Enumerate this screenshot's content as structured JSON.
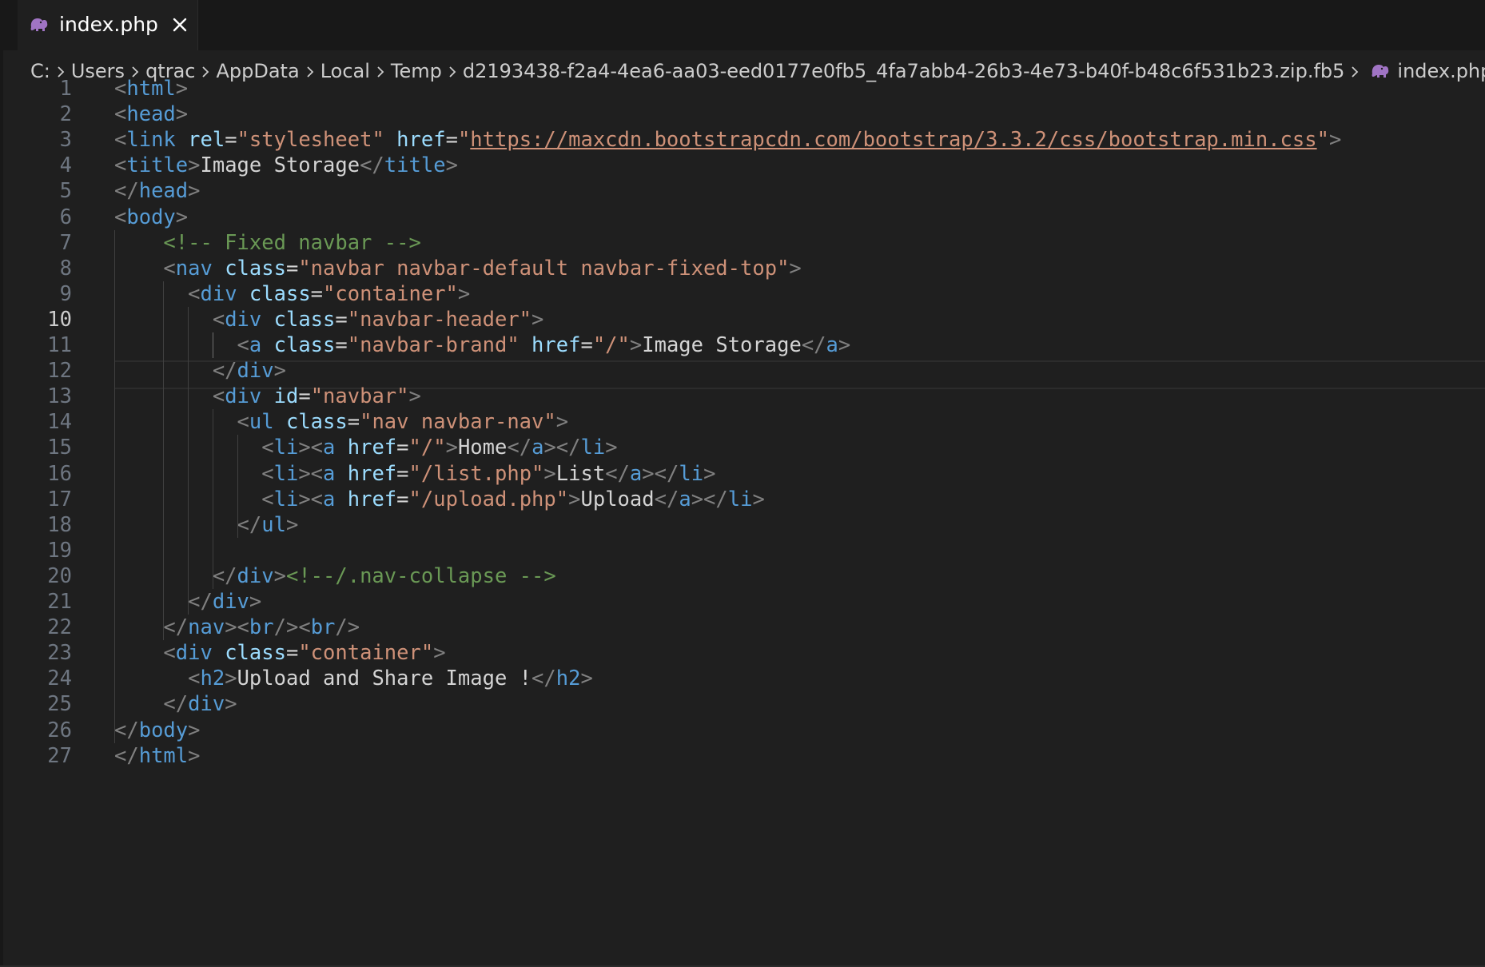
{
  "tab": {
    "title": "index.php",
    "icon": "php-elephant-icon",
    "close_icon": "close-icon"
  },
  "breadcrumb": {
    "items": [
      "C:",
      "Users",
      "qtrac",
      "AppData",
      "Local",
      "Temp",
      "d2193438-f2a4-4ea6-aa03-eed0177e0fb5_4fa7abb4-26b3-4e73-b40f-b48c6f531b23.zip.fb5",
      "index.php"
    ],
    "separator_icon": "chevron-right-icon",
    "file_icon": "php-elephant-icon"
  },
  "editor": {
    "active_line": 10,
    "colors": {
      "background": "#1f1f1f",
      "tag": "#569cd6",
      "attribute": "#9cdcfe",
      "string": "#ce9178",
      "comment": "#6a9955",
      "punctuation": "#808080",
      "text": "#d4d4d4"
    },
    "lines": [
      {
        "n": "1",
        "t": [
          [
            "p",
            "<"
          ],
          [
            "tag",
            "html"
          ],
          [
            "p",
            ">"
          ]
        ]
      },
      {
        "n": "2",
        "t": [
          [
            "p",
            "<"
          ],
          [
            "tag",
            "head"
          ],
          [
            "p",
            ">"
          ]
        ]
      },
      {
        "n": "3",
        "t": [
          [
            "p",
            "<"
          ],
          [
            "tag",
            "link"
          ],
          [
            "txt",
            " "
          ],
          [
            "attr",
            "rel"
          ],
          [
            "txt",
            "="
          ],
          [
            "str",
            "\"stylesheet\""
          ],
          [
            "txt",
            " "
          ],
          [
            "attr",
            "href"
          ],
          [
            "txt",
            "="
          ],
          [
            "str",
            "\""
          ],
          [
            "link",
            "https://maxcdn.bootstrapcdn.com/bootstrap/3.3.2/css/bootstrap.min.css"
          ],
          [
            "str",
            "\""
          ],
          [
            "p",
            ">"
          ]
        ]
      },
      {
        "n": "4",
        "t": [
          [
            "p",
            "<"
          ],
          [
            "tag",
            "title"
          ],
          [
            "p",
            ">"
          ],
          [
            "txt",
            "Image Storage"
          ],
          [
            "p",
            "</"
          ],
          [
            "tag",
            "title"
          ],
          [
            "p",
            ">"
          ]
        ]
      },
      {
        "n": "5",
        "t": [
          [
            "p",
            "</"
          ],
          [
            "tag",
            "head"
          ],
          [
            "p",
            ">"
          ]
        ]
      },
      {
        "n": "6",
        "t": [
          [
            "p",
            "<"
          ],
          [
            "tag",
            "body"
          ],
          [
            "p",
            ">"
          ]
        ]
      },
      {
        "n": "7",
        "t": [
          [
            "txt",
            "    "
          ],
          [
            "com",
            "<!-- Fixed navbar -->"
          ]
        ]
      },
      {
        "n": "8",
        "t": [
          [
            "txt",
            "    "
          ],
          [
            "p",
            "<"
          ],
          [
            "tag",
            "nav"
          ],
          [
            "txt",
            " "
          ],
          [
            "attr",
            "class"
          ],
          [
            "txt",
            "="
          ],
          [
            "str",
            "\"navbar navbar-default navbar-fixed-top\""
          ],
          [
            "p",
            ">"
          ]
        ]
      },
      {
        "n": "9",
        "t": [
          [
            "txt",
            "      "
          ],
          [
            "p",
            "<"
          ],
          [
            "tag",
            "div"
          ],
          [
            "txt",
            " "
          ],
          [
            "attr",
            "class"
          ],
          [
            "txt",
            "="
          ],
          [
            "str",
            "\"container\""
          ],
          [
            "p",
            ">"
          ]
        ]
      },
      {
        "n": "10",
        "t": [
          [
            "txt",
            "        "
          ],
          [
            "p",
            "<"
          ],
          [
            "tag",
            "div"
          ],
          [
            "txt",
            " "
          ],
          [
            "attr",
            "class"
          ],
          [
            "txt",
            "="
          ],
          [
            "str",
            "\"navbar-header\""
          ],
          [
            "p",
            ">"
          ]
        ]
      },
      {
        "n": "11",
        "t": [
          [
            "txt",
            "          "
          ],
          [
            "p",
            "<"
          ],
          [
            "tag",
            "a"
          ],
          [
            "txt",
            " "
          ],
          [
            "attr",
            "class"
          ],
          [
            "txt",
            "="
          ],
          [
            "str",
            "\"navbar-brand\""
          ],
          [
            "txt",
            " "
          ],
          [
            "attr",
            "href"
          ],
          [
            "txt",
            "="
          ],
          [
            "str",
            "\"/\""
          ],
          [
            "p",
            ">"
          ],
          [
            "txt",
            "Image Storage"
          ],
          [
            "p",
            "</"
          ],
          [
            "tag",
            "a"
          ],
          [
            "p",
            ">"
          ]
        ]
      },
      {
        "n": "12",
        "t": [
          [
            "txt",
            "        "
          ],
          [
            "p",
            "</"
          ],
          [
            "tag",
            "div"
          ],
          [
            "p",
            ">"
          ]
        ]
      },
      {
        "n": "13",
        "t": [
          [
            "txt",
            "        "
          ],
          [
            "p",
            "<"
          ],
          [
            "tag",
            "div"
          ],
          [
            "txt",
            " "
          ],
          [
            "attr",
            "id"
          ],
          [
            "txt",
            "="
          ],
          [
            "str",
            "\"navbar\""
          ],
          [
            "p",
            ">"
          ]
        ]
      },
      {
        "n": "14",
        "t": [
          [
            "txt",
            "          "
          ],
          [
            "p",
            "<"
          ],
          [
            "tag",
            "ul"
          ],
          [
            "txt",
            " "
          ],
          [
            "attr",
            "class"
          ],
          [
            "txt",
            "="
          ],
          [
            "str",
            "\"nav navbar-nav\""
          ],
          [
            "p",
            ">"
          ]
        ]
      },
      {
        "n": "15",
        "t": [
          [
            "txt",
            "            "
          ],
          [
            "p",
            "<"
          ],
          [
            "tag",
            "li"
          ],
          [
            "p",
            "><"
          ],
          [
            "tag",
            "a"
          ],
          [
            "txt",
            " "
          ],
          [
            "attr",
            "href"
          ],
          [
            "txt",
            "="
          ],
          [
            "str",
            "\"/\""
          ],
          [
            "p",
            ">"
          ],
          [
            "txt",
            "Home"
          ],
          [
            "p",
            "</"
          ],
          [
            "tag",
            "a"
          ],
          [
            "p",
            "></"
          ],
          [
            "tag",
            "li"
          ],
          [
            "p",
            ">"
          ]
        ]
      },
      {
        "n": "16",
        "t": [
          [
            "txt",
            "            "
          ],
          [
            "p",
            "<"
          ],
          [
            "tag",
            "li"
          ],
          [
            "p",
            "><"
          ],
          [
            "tag",
            "a"
          ],
          [
            "txt",
            " "
          ],
          [
            "attr",
            "href"
          ],
          [
            "txt",
            "="
          ],
          [
            "str",
            "\"/list.php\""
          ],
          [
            "p",
            ">"
          ],
          [
            "txt",
            "List"
          ],
          [
            "p",
            "</"
          ],
          [
            "tag",
            "a"
          ],
          [
            "p",
            "></"
          ],
          [
            "tag",
            "li"
          ],
          [
            "p",
            ">"
          ]
        ]
      },
      {
        "n": "17",
        "t": [
          [
            "txt",
            "            "
          ],
          [
            "p",
            "<"
          ],
          [
            "tag",
            "li"
          ],
          [
            "p",
            "><"
          ],
          [
            "tag",
            "a"
          ],
          [
            "txt",
            " "
          ],
          [
            "attr",
            "href"
          ],
          [
            "txt",
            "="
          ],
          [
            "str",
            "\"/upload.php\""
          ],
          [
            "p",
            ">"
          ],
          [
            "txt",
            "Upload"
          ],
          [
            "p",
            "</"
          ],
          [
            "tag",
            "a"
          ],
          [
            "p",
            "></"
          ],
          [
            "tag",
            "li"
          ],
          [
            "p",
            ">"
          ]
        ]
      },
      {
        "n": "18",
        "t": [
          [
            "txt",
            "          "
          ],
          [
            "p",
            "</"
          ],
          [
            "tag",
            "ul"
          ],
          [
            "p",
            ">"
          ]
        ]
      },
      {
        "n": "19",
        "t": []
      },
      {
        "n": "20",
        "t": [
          [
            "txt",
            "        "
          ],
          [
            "p",
            "</"
          ],
          [
            "tag",
            "div"
          ],
          [
            "p",
            ">"
          ],
          [
            "com",
            "<!--/.nav-collapse -->"
          ]
        ]
      },
      {
        "n": "21",
        "t": [
          [
            "txt",
            "      "
          ],
          [
            "p",
            "</"
          ],
          [
            "tag",
            "div"
          ],
          [
            "p",
            ">"
          ]
        ]
      },
      {
        "n": "22",
        "t": [
          [
            "txt",
            "    "
          ],
          [
            "p",
            "</"
          ],
          [
            "tag",
            "nav"
          ],
          [
            "p",
            "><"
          ],
          [
            "tag",
            "br"
          ],
          [
            "p",
            "/><"
          ],
          [
            "tag",
            "br"
          ],
          [
            "p",
            "/>"
          ]
        ]
      },
      {
        "n": "23",
        "t": [
          [
            "txt",
            "    "
          ],
          [
            "p",
            "<"
          ],
          [
            "tag",
            "div"
          ],
          [
            "txt",
            " "
          ],
          [
            "attr",
            "class"
          ],
          [
            "txt",
            "="
          ],
          [
            "str",
            "\"container\""
          ],
          [
            "p",
            ">"
          ]
        ]
      },
      {
        "n": "24",
        "t": [
          [
            "txt",
            "      "
          ],
          [
            "p",
            "<"
          ],
          [
            "tag",
            "h2"
          ],
          [
            "p",
            ">"
          ],
          [
            "txt",
            "Upload and Share Image !"
          ],
          [
            "p",
            "</"
          ],
          [
            "tag",
            "h2"
          ],
          [
            "p",
            ">"
          ]
        ]
      },
      {
        "n": "25",
        "t": [
          [
            "txt",
            "    "
          ],
          [
            "p",
            "</"
          ],
          [
            "tag",
            "div"
          ],
          [
            "p",
            ">"
          ]
        ]
      },
      {
        "n": "26",
        "t": [
          [
            "p",
            "</"
          ],
          [
            "tag",
            "body"
          ],
          [
            "p",
            ">"
          ]
        ]
      },
      {
        "n": "27",
        "t": [
          [
            "p",
            "</"
          ],
          [
            "tag",
            "html"
          ],
          [
            "p",
            ">"
          ]
        ]
      }
    ]
  }
}
